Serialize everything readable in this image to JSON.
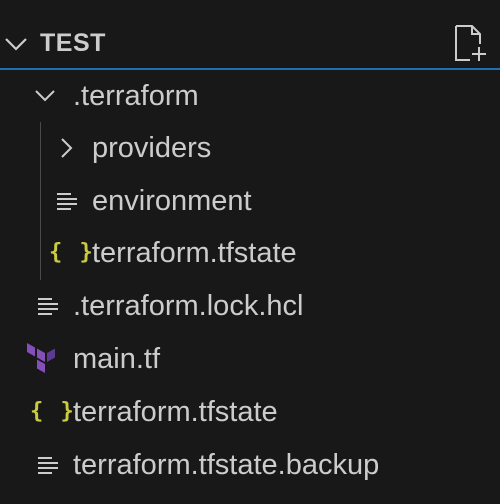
{
  "explorer": {
    "section_title": "TEST",
    "header_icons": {
      "collapse": "chevron-down-icon",
      "new_file": "new-file-icon"
    },
    "accent_color": "#1f6fb8",
    "items": [
      {
        "label": ".terraform",
        "kind": "folder",
        "expanded": true,
        "icon": "chevron-down-icon"
      },
      {
        "label": "providers",
        "kind": "folder",
        "expanded": false,
        "icon": "chevron-right-icon"
      },
      {
        "label": "environment",
        "kind": "file",
        "icon": "lines-file-icon"
      },
      {
        "label": "terraform.tfstate",
        "kind": "file",
        "icon": "json-braces-icon"
      },
      {
        "label": ".terraform.lock.hcl",
        "kind": "file",
        "icon": "lines-file-icon"
      },
      {
        "label": "main.tf",
        "kind": "file",
        "icon": "terraform-icon"
      },
      {
        "label": "terraform.tfstate",
        "kind": "file",
        "icon": "json-braces-icon"
      },
      {
        "label": "terraform.tfstate.backup",
        "kind": "file",
        "icon": "lines-file-icon"
      }
    ],
    "json_glyph": "{ }"
  }
}
